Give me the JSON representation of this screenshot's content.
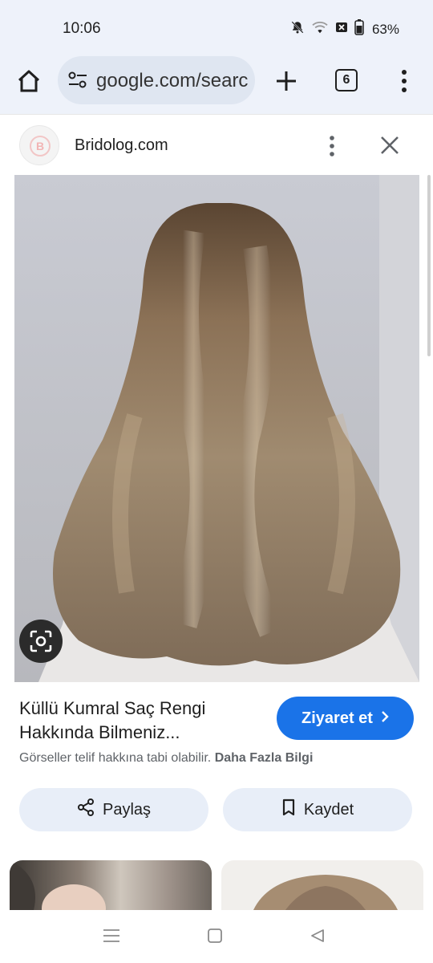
{
  "status_bar": {
    "time": "10:06",
    "battery_percent": "63%",
    "icons": [
      "bell-off-icon",
      "wifi-icon",
      "no-sim-icon",
      "battery-icon"
    ]
  },
  "toolbar": {
    "url": "google.com/search",
    "tab_count": "6",
    "icons": [
      "home-icon",
      "tune-icon",
      "plus-icon",
      "tab-switcher-icon",
      "more-vert-icon"
    ]
  },
  "source": {
    "site_name": "Bridolog.com",
    "logo_letter": "B"
  },
  "result": {
    "title": "Küllü Kumral Saç Rengi Hakkında Bilmeniz...",
    "visit_label": "Ziyaret et",
    "copyright_text": "Görseller telif hakkına tabi olabilir.",
    "copyright_link": "Daha Fazla Bilgi",
    "share_label": "Paylaş",
    "save_label": "Kaydet"
  },
  "colors": {
    "chrome_bg": "#eef2fa",
    "accent_blue": "#1a73e8",
    "chip_bg": "#e8eef8"
  },
  "navbar": {
    "icons": [
      "menu-icon",
      "home-square-icon",
      "back-triangle-icon"
    ]
  }
}
